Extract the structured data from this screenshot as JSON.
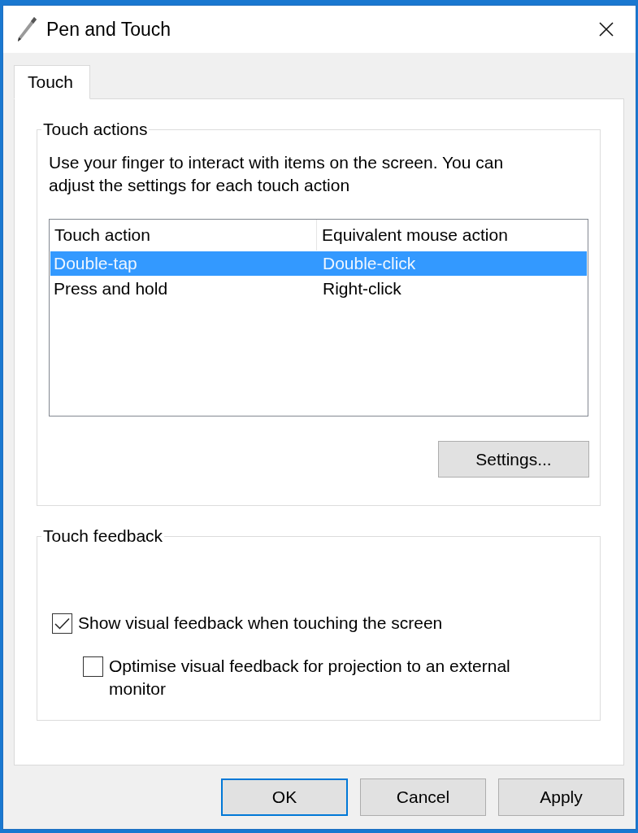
{
  "window": {
    "title": "Pen and Touch"
  },
  "tabs": [
    {
      "label": "Touch",
      "selected": true
    }
  ],
  "touch_actions": {
    "title": "Touch actions",
    "description": "Use your finger to interact with items on the screen. You can adjust the settings for each touch action",
    "columns": [
      "Touch action",
      "Equivalent mouse action"
    ],
    "rows": [
      {
        "cells": [
          "Double-tap",
          "Double-click"
        ],
        "selected": true
      },
      {
        "cells": [
          "Press and hold",
          "Right-click"
        ],
        "selected": false
      }
    ],
    "settings_button": "Settings..."
  },
  "touch_feedback": {
    "title": "Touch feedback",
    "options": [
      {
        "label": "Show visual feedback when touching the screen",
        "checked": true,
        "children": [
          {
            "label": "Optimise visual feedback for projection to an external monitor",
            "checked": false
          }
        ]
      }
    ]
  },
  "buttons": [
    {
      "label": "OK",
      "default": true
    },
    {
      "label": "Cancel",
      "default": false
    },
    {
      "label": "Apply",
      "default": false
    }
  ]
}
